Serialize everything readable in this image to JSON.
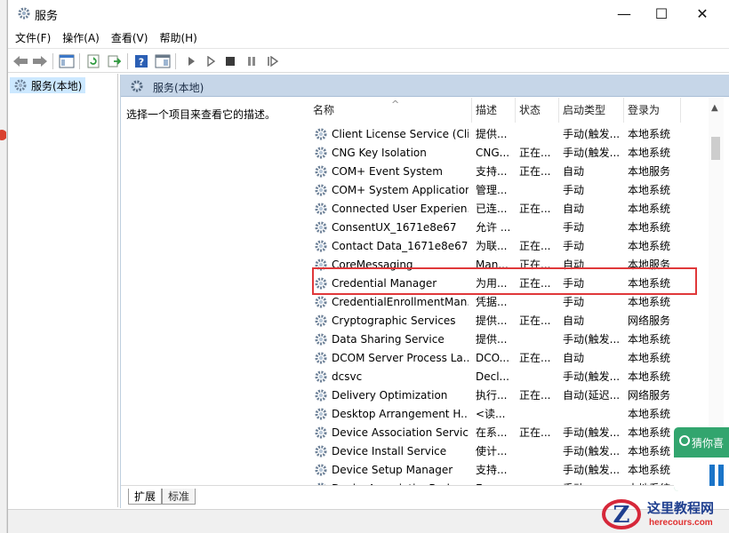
{
  "window": {
    "title": "服务",
    "controls": {
      "minimize": "—",
      "maximize": "☐",
      "close": "✕"
    }
  },
  "menu": [
    "文件(F)",
    "操作(A)",
    "查看(V)",
    "帮助(H)"
  ],
  "tree": {
    "item": "服务(本地)"
  },
  "pane": {
    "title": "服务(本地)",
    "description_prompt": "选择一个项目来查看它的描述。"
  },
  "columns": {
    "name": "名称",
    "description": "描述",
    "status": "状态",
    "startup": "启动类型",
    "logon": "登录为"
  },
  "services": [
    {
      "name": "Client License Service (Cli...",
      "desc": "提供...",
      "status": "",
      "startup": "手动(触发...",
      "logon": "本地系统"
    },
    {
      "name": "CNG Key Isolation",
      "desc": "CNG...",
      "status": "正在...",
      "startup": "手动(触发...",
      "logon": "本地系统"
    },
    {
      "name": "COM+ Event System",
      "desc": "支持...",
      "status": "正在...",
      "startup": "自动",
      "logon": "本地服务"
    },
    {
      "name": "COM+ System Application",
      "desc": "管理...",
      "status": "",
      "startup": "手动",
      "logon": "本地系统"
    },
    {
      "name": "Connected User Experien...",
      "desc": "已连...",
      "status": "正在...",
      "startup": "自动",
      "logon": "本地系统"
    },
    {
      "name": "ConsentUX_1671e8e67",
      "desc": "允许 ...",
      "status": "",
      "startup": "手动",
      "logon": "本地系统"
    },
    {
      "name": "Contact Data_1671e8e67",
      "desc": "为联...",
      "status": "正在...",
      "startup": "手动",
      "logon": "本地系统"
    },
    {
      "name": "CoreMessaging",
      "desc": "Man...",
      "status": "正在...",
      "startup": "自动",
      "logon": "本地服务"
    },
    {
      "name": "Credential Manager",
      "desc": "为用...",
      "status": "正在...",
      "startup": "手动",
      "logon": "本地系统"
    },
    {
      "name": "CredentialEnrollmentMan...",
      "desc": "凭据...",
      "status": "",
      "startup": "手动",
      "logon": "本地系统"
    },
    {
      "name": "Cryptographic Services",
      "desc": "提供...",
      "status": "正在...",
      "startup": "自动",
      "logon": "网络服务"
    },
    {
      "name": "Data Sharing Service",
      "desc": "提供...",
      "status": "",
      "startup": "手动(触发...",
      "logon": "本地系统"
    },
    {
      "name": "DCOM Server Process La...",
      "desc": "DCO...",
      "status": "正在...",
      "startup": "自动",
      "logon": "本地系统"
    },
    {
      "name": "dcsvc",
      "desc": "Decl...",
      "status": "",
      "startup": "手动(触发...",
      "logon": "本地系统"
    },
    {
      "name": "Delivery Optimization",
      "desc": "执行...",
      "status": "正在...",
      "startup": "自动(延迟...",
      "logon": "网络服务"
    },
    {
      "name": "Desktop Arrangement H...",
      "desc": "<读...",
      "status": "",
      "startup": "",
      "logon": "本地系统"
    },
    {
      "name": "Device Association Service",
      "desc": "在系...",
      "status": "正在...",
      "startup": "手动(触发...",
      "logon": "本地系统"
    },
    {
      "name": "Device Install Service",
      "desc": "使计...",
      "status": "",
      "startup": "手动(触发...",
      "logon": "本地系统"
    },
    {
      "name": "Device Setup Manager",
      "desc": "支持...",
      "status": "",
      "startup": "手动(触发...",
      "logon": "本地系统"
    },
    {
      "name": "DeviceAssociationBroker...",
      "desc": "Ena...",
      "status": "",
      "startup": "手动",
      "logon": "本地系统"
    }
  ],
  "tabs": [
    "扩展",
    "标准"
  ],
  "widget": {
    "label": "猜你喜"
  },
  "watermark": {
    "title": "这里教程网",
    "url": "herecours.com"
  },
  "colors": {
    "highlight_border": "#e0383a",
    "header_bg": "#c6d6e8",
    "selected_bg": "#cce8ff"
  }
}
